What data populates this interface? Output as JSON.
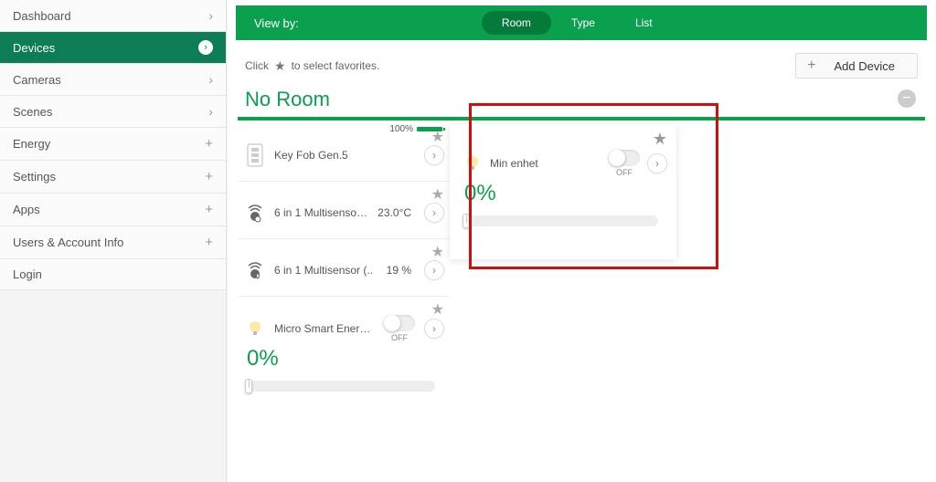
{
  "sidebar": {
    "items": [
      {
        "label": "Dashboard",
        "glyph": "chev"
      },
      {
        "label": "Devices",
        "glyph": "chev",
        "active": true
      },
      {
        "label": "Cameras",
        "glyph": "chev"
      },
      {
        "label": "Scenes",
        "glyph": "chev"
      },
      {
        "label": "Energy",
        "glyph": "plus"
      },
      {
        "label": "Settings",
        "glyph": "plus"
      },
      {
        "label": "Apps",
        "glyph": "plus"
      },
      {
        "label": "Users & Account Info",
        "glyph": "plus"
      },
      {
        "label": "Login",
        "glyph": ""
      }
    ]
  },
  "topbar": {
    "view_by": "View by:",
    "tabs": [
      "Room",
      "Type",
      "List"
    ],
    "active_tab": 0
  },
  "hint": {
    "prefix": "Click",
    "suffix": "to select favorites."
  },
  "add_device_label": "Add Device",
  "section": {
    "title": "No Room"
  },
  "devices_left": [
    {
      "name": "Key Fob Gen.5",
      "battery": "100%",
      "value": "",
      "icon": "keyfob"
    },
    {
      "name": "6 in 1 Multisensor (..",
      "value": "23.0°C",
      "icon": "sensor"
    },
    {
      "name": "6 in 1 Multisensor (..",
      "value": "19 %",
      "icon": "sensor"
    },
    {
      "name": "Micro Smart Energy D..",
      "value": "",
      "icon": "bulb",
      "toggle_label": "OFF",
      "percent": "0%"
    }
  ],
  "device_right": {
    "name": "Min enhet",
    "toggle_label": "OFF",
    "percent": "0%"
  }
}
